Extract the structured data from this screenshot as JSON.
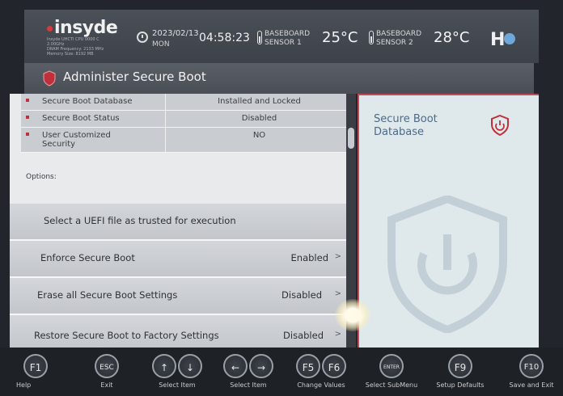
{
  "header": {
    "logo": "insyde",
    "system_info": [
      "Insyde UHCTI CPU 0000 C",
      "2.00GHz",
      "DRAM Frequency: 2133 MHz",
      "Memory Size: 8192 MB"
    ],
    "date": "2023/02/13",
    "day": "MON",
    "time": "04:58:23",
    "sensors": [
      {
        "name_line1": "BASEBOARD",
        "name_line2": "SENSOR 1",
        "temp": "25°C"
      },
      {
        "name_line1": "BASEBOARD",
        "name_line2": "SENSOR 2",
        "temp": "28°C"
      }
    ]
  },
  "page": {
    "title": "Administer Secure Boot"
  },
  "info_rows": [
    {
      "key": "Secure Boot Database",
      "value": "Installed and Locked"
    },
    {
      "key": "Secure Boot Status",
      "value": "Disabled"
    },
    {
      "key": "User Customized Security",
      "value": "NO"
    }
  ],
  "options_label": "Options:",
  "options": [
    {
      "label": "Select a UEFI file as trusted for execution",
      "value": "",
      "arrow": ""
    },
    {
      "label": "Enforce Secure Boot",
      "value": "Enabled",
      "arrow": ">"
    },
    {
      "label": "Erase all Secure Boot Settings",
      "value": "Disabled",
      "arrow": ">"
    },
    {
      "label": "Restore Secure Boot to Factory Settings",
      "value": "Disabled",
      "arrow": ">"
    }
  ],
  "help": {
    "title": "Secure Boot Database",
    "icon": "shield-power-icon"
  },
  "footer": [
    {
      "key": "F1",
      "label": "Help",
      "icon": "f1-icon"
    },
    {
      "key": "ESC",
      "label": "Exit",
      "icon": "esc-icon"
    },
    {
      "key": "↑↓",
      "label": "Select Item",
      "icon": "up-down-arrows-icon"
    },
    {
      "key": "←→",
      "label": "Select Item",
      "icon": "left-right-arrows-icon"
    },
    {
      "key": "F5 F6",
      "label": "Change Values",
      "icon": "f5-f6-icon"
    },
    {
      "key": "ENTER",
      "label": "Select  SubMenu",
      "icon": "enter-icon"
    },
    {
      "key": "F9",
      "label": "Setup Defaults",
      "icon": "f9-icon"
    },
    {
      "key": "F10",
      "label": "Save and Exit",
      "icon": "f10-icon"
    }
  ],
  "colors": {
    "accent_red": "#c0303a",
    "help_text_blue": "#4d6a86",
    "header_bg": "#4b5058",
    "panel_bg": "#e8eaec"
  }
}
